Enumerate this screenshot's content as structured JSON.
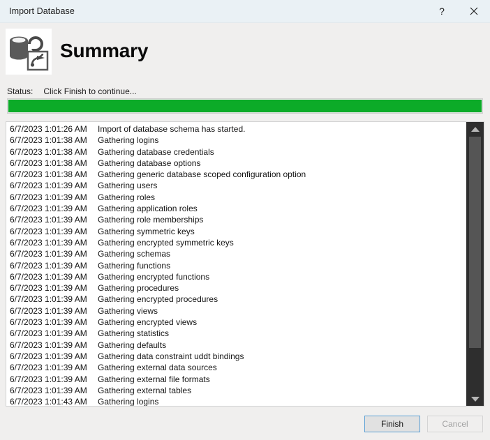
{
  "window": {
    "title": "Import Database",
    "help_label": "?",
    "close_label": "✕"
  },
  "header": {
    "heading": "Summary",
    "icon": "database-import-icon"
  },
  "status": {
    "label": "Status:",
    "value": "Click Finish to continue..."
  },
  "progress": {
    "percent": 100,
    "color": "#0cab28"
  },
  "log": {
    "columns": [
      "Timestamp",
      "Message"
    ],
    "rows": [
      {
        "time": "6/7/2023 1:01:26 AM",
        "message": "Import of database schema has started."
      },
      {
        "time": "6/7/2023 1:01:38 AM",
        "message": "Gathering logins"
      },
      {
        "time": "6/7/2023 1:01:38 AM",
        "message": "Gathering database credentials"
      },
      {
        "time": "6/7/2023 1:01:38 AM",
        "message": "Gathering database options"
      },
      {
        "time": "6/7/2023 1:01:38 AM",
        "message": "Gathering generic database scoped configuration option"
      },
      {
        "time": "6/7/2023 1:01:39 AM",
        "message": "Gathering users"
      },
      {
        "time": "6/7/2023 1:01:39 AM",
        "message": "Gathering roles"
      },
      {
        "time": "6/7/2023 1:01:39 AM",
        "message": "Gathering application roles"
      },
      {
        "time": "6/7/2023 1:01:39 AM",
        "message": "Gathering role memberships"
      },
      {
        "time": "6/7/2023 1:01:39 AM",
        "message": "Gathering symmetric keys"
      },
      {
        "time": "6/7/2023 1:01:39 AM",
        "message": "Gathering encrypted symmetric keys"
      },
      {
        "time": "6/7/2023 1:01:39 AM",
        "message": "Gathering schemas"
      },
      {
        "time": "6/7/2023 1:01:39 AM",
        "message": "Gathering functions"
      },
      {
        "time": "6/7/2023 1:01:39 AM",
        "message": "Gathering encrypted functions"
      },
      {
        "time": "6/7/2023 1:01:39 AM",
        "message": "Gathering procedures"
      },
      {
        "time": "6/7/2023 1:01:39 AM",
        "message": "Gathering encrypted procedures"
      },
      {
        "time": "6/7/2023 1:01:39 AM",
        "message": "Gathering views"
      },
      {
        "time": "6/7/2023 1:01:39 AM",
        "message": "Gathering encrypted views"
      },
      {
        "time": "6/7/2023 1:01:39 AM",
        "message": "Gathering statistics"
      },
      {
        "time": "6/7/2023 1:01:39 AM",
        "message": "Gathering defaults"
      },
      {
        "time": "6/7/2023 1:01:39 AM",
        "message": "Gathering data constraint uddt bindings"
      },
      {
        "time": "6/7/2023 1:01:39 AM",
        "message": "Gathering external data sources"
      },
      {
        "time": "6/7/2023 1:01:39 AM",
        "message": "Gathering external file formats"
      },
      {
        "time": "6/7/2023 1:01:39 AM",
        "message": "Gathering external tables"
      },
      {
        "time": "6/7/2023 1:01:43 AM",
        "message": "Gathering logins"
      }
    ]
  },
  "footer": {
    "finish_label": "Finish",
    "cancel_label": "Cancel"
  }
}
